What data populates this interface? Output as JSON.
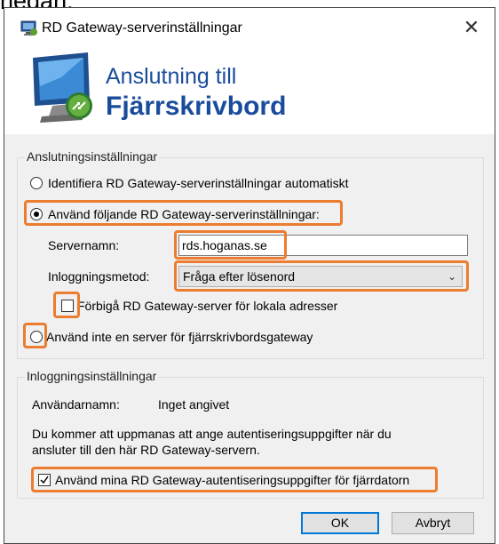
{
  "page_cutoff_text": "nedan:",
  "dialog": {
    "title": "RD Gateway-serverinställningar",
    "close_symbol": "✕"
  },
  "banner": {
    "line1": "Anslutning till",
    "line2": "Fjärrskrivbord"
  },
  "connection_settings": {
    "group_title": "Anslutningsinställningar",
    "radio_auto": "Identifiera RD Gateway-serverinställningar automatiskt",
    "radio_use_following": "Använd följande RD Gateway-serverinställningar:",
    "server_name_label": "Servernamn:",
    "server_name_value": "rds.hoganas.se",
    "logon_method_label": "Inloggningsmetod:",
    "logon_method_value": "Fråga efter lösenord",
    "bypass_label": "Förbigå RD Gateway-server för lokala adresser",
    "bypass_checked": false,
    "radio_no_server": "Använd inte en server för fjärrskrivbordsgateway",
    "selected_option": "use_following"
  },
  "logon_settings": {
    "group_title": "Inloggningsinställningar",
    "username_label": "Användarnamn:",
    "username_value": "Inget angivet",
    "info_text_1": "Du kommer att uppmanas att ange autentiseringsuppgifter när du",
    "info_text_2": "ansluter till den här RD Gateway-servern.",
    "use_credentials_label": "Använd mina RD Gateway-autentiseringsuppgifter för fjärrdatorn",
    "use_credentials_checked": true
  },
  "buttons": {
    "ok": "OK",
    "cancel": "Avbryt"
  },
  "icons": {
    "app": "remote-desktop-icon",
    "banner": "remote-desktop-monitor-icon",
    "close": "close-icon",
    "dropdown": "chevron-down-icon",
    "check": "checkmark-icon"
  },
  "colors": {
    "highlight": "#ec7c30",
    "banner_text": "#1a4c9c",
    "dialog_body": "#f0f0f0",
    "default_button_border": "#0078d7"
  }
}
